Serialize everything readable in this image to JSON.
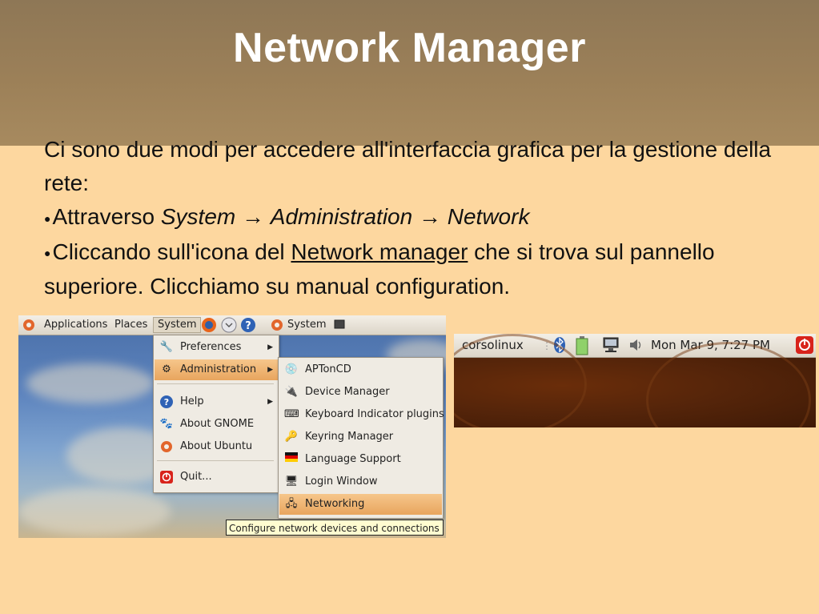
{
  "slide": {
    "title": "Network Manager",
    "intro": "Ci sono due modi per accedere all'interfaccia grafica per la gestione della rete:",
    "bullet1": {
      "prefix": "Attraverso ",
      "path_system": "System",
      "path_admin": "Administration",
      "path_network": "Network",
      "arrow": "→"
    },
    "bullet2": {
      "prefix": "Cliccando sull'icona del ",
      "link": "Network manager",
      "suffix": " che si trova sul pannello superiore. Clicchiamo su manual configuration."
    }
  },
  "screenshot1": {
    "panel": {
      "applications": "Applications",
      "places": "Places",
      "system": "System",
      "system2": "System"
    },
    "system_menu": [
      {
        "label": "Preferences",
        "icon": "preferences-icon",
        "submenu": true
      },
      {
        "label": "Administration",
        "icon": "administration-icon",
        "submenu": true,
        "highlighted": true
      },
      {
        "label": "Help",
        "icon": "help-icon",
        "submenu": true
      },
      {
        "label": "About GNOME",
        "icon": "gnome-foot-icon"
      },
      {
        "label": "About Ubuntu",
        "icon": "ubuntu-logo-icon"
      },
      {
        "label": "Quit...",
        "icon": "quit-icon"
      }
    ],
    "admin_menu": [
      {
        "label": "APTonCD",
        "icon": "cd-icon"
      },
      {
        "label": "Device Manager",
        "icon": "device-manager-icon"
      },
      {
        "label": "Keyboard Indicator plugins",
        "icon": "keyboard-icon"
      },
      {
        "label": "Keyring Manager",
        "icon": "keyring-icon"
      },
      {
        "label": "Language Support",
        "icon": "flag-icon"
      },
      {
        "label": "Login Window",
        "icon": "login-window-icon"
      },
      {
        "label": "Networking",
        "icon": "networking-icon",
        "highlighted": true
      }
    ],
    "tooltip": "Configure network devices and connections"
  },
  "screenshot2": {
    "hostname": "corsolinux",
    "clock": "Mon Mar  9,  7:27 PM",
    "icons": [
      "bluetooth-icon",
      "battery-icon",
      "network-manager-icon",
      "volume-icon",
      "power-icon"
    ]
  },
  "colors": {
    "background": "#fdd79f",
    "header": "#9c8058",
    "highlight": "#e8a55e",
    "tooltip": "#fffcd0"
  }
}
